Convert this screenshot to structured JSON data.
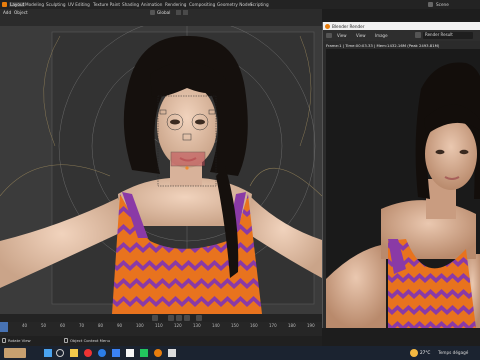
{
  "workspaces": [
    "Layout",
    "Modeling",
    "Sculpting",
    "UV Editing",
    "Texture Paint",
    "Shading",
    "Animation",
    "Rendering",
    "Compositing",
    "Geometry Nodes",
    "Scripting"
  ],
  "scene_label": "Scene",
  "viewport_header": {
    "mode": "Add",
    "object_menu": "Object",
    "orientation": "Global"
  },
  "timeline_ticks": [
    "0",
    "40",
    "50",
    "60",
    "70",
    "80",
    "90",
    "100",
    "110",
    "120",
    "130",
    "140",
    "150",
    "160",
    "170",
    "180",
    "190"
  ],
  "status_left": "Rotate View",
  "status_middle": "Object Context Menu",
  "render_window": {
    "title": "Blender Render",
    "menus": [
      "View",
      "View",
      "Image"
    ],
    "slot": "Render Result",
    "info": "Frame:1 | Time:00:03.33 | Mem:1432.16M (Peak 2493.81M)"
  },
  "taskbar": {
    "weather": "27°C",
    "weather_desc": "Temps dégagé"
  },
  "colors": {
    "accent": "#e87d0d",
    "dress_purple": "#8a3aa6",
    "dress_orange": "#e8731e"
  }
}
